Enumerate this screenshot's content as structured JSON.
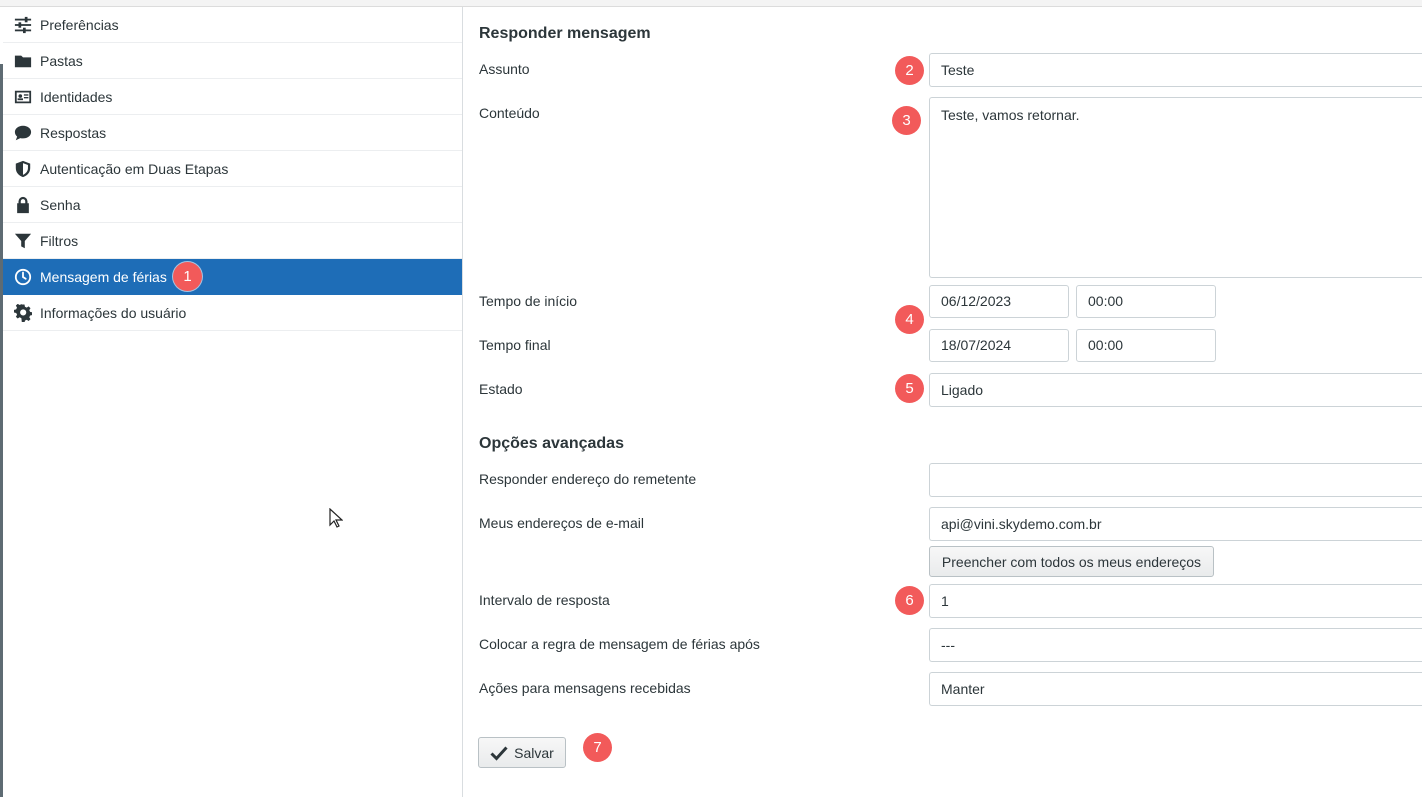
{
  "sidebar": {
    "items": [
      {
        "label": "Preferências",
        "icon": "sliders-icon"
      },
      {
        "label": "Pastas",
        "icon": "folder-icon"
      },
      {
        "label": "Identidades",
        "icon": "id-card-icon"
      },
      {
        "label": "Respostas",
        "icon": "comment-icon"
      },
      {
        "label": "Autenticação em Duas Etapas",
        "icon": "shield-icon"
      },
      {
        "label": "Senha",
        "icon": "lock-icon"
      },
      {
        "label": "Filtros",
        "icon": "filter-icon"
      },
      {
        "label": "Mensagem de férias",
        "icon": "clock-icon",
        "active": true
      },
      {
        "label": "Informações do usuário",
        "icon": "gear-icon"
      }
    ]
  },
  "badges": [
    "1",
    "2",
    "3",
    "4",
    "5",
    "6",
    "7"
  ],
  "form": {
    "reply_heading": "Responder mensagem",
    "subject_label": "Assunto",
    "subject_value": "Teste",
    "content_label": "Conteúdo",
    "content_value": "Teste, vamos retornar.",
    "start_label": "Tempo de início",
    "start_date": "06/12/2023",
    "start_time": "00:00",
    "end_label": "Tempo final",
    "end_date": "18/07/2024",
    "end_time": "00:00",
    "status_label": "Estado",
    "status_value": "Ligado",
    "advanced_heading": "Opções avançadas",
    "reply_address_label": "Responder endereço do remetente",
    "reply_address_value": "",
    "my_addresses_label": "Meus endereços de e-mail",
    "my_addresses_value": "api@vini.skydemo.com.br",
    "fill_all_button": "Preencher com todos os meus endereços",
    "interval_label": "Intervalo de resposta",
    "interval_value": "1",
    "rule_after_label": "Colocar a regra de mensagem de férias após",
    "rule_after_value": "---",
    "actions_label": "Ações para mensagens recebidas",
    "actions_value": "Manter",
    "save_button": "Salvar"
  },
  "colors": {
    "accent": "#1e6db7",
    "badge": "#f25a5a"
  }
}
